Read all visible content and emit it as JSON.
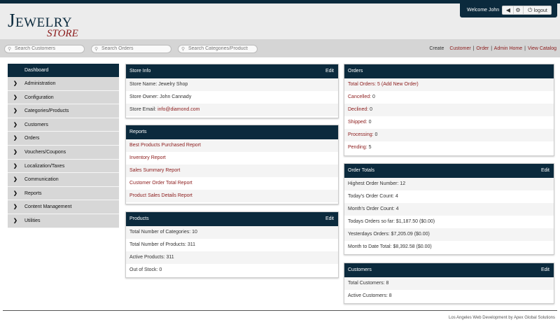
{
  "logo": {
    "top": "Jewelry",
    "bottom": "Store"
  },
  "user": {
    "welcome": "Welcome John",
    "logout": "logout"
  },
  "search": {
    "customers_placeholder": "Search Customers",
    "orders_placeholder": "Search Orders",
    "categories_placeholder": "Search Categories/Products"
  },
  "toplinks": {
    "create": "Create",
    "customer": "Customer",
    "order": "Order",
    "admin_home": "Admin Home",
    "view_catalog": "View Catalog",
    "sep": "|"
  },
  "sidebar": {
    "header": "Dashboard",
    "chevron": "❯",
    "items": [
      {
        "label": "Administration"
      },
      {
        "label": "Configuration"
      },
      {
        "label": "Categories/Products"
      },
      {
        "label": "Customers"
      },
      {
        "label": "Orders"
      },
      {
        "label": "Vouchers/Coupons"
      },
      {
        "label": "Localization/Taxes"
      },
      {
        "label": "Communication"
      },
      {
        "label": "Reports"
      },
      {
        "label": "Content Management"
      },
      {
        "label": "Utilities"
      }
    ]
  },
  "store_info": {
    "title": "Store Info",
    "edit": "Edit",
    "name": "Store Name: Jewelry Shop",
    "owner": "Store Owner: John Cannady",
    "email_label": "Store Email: ",
    "email": "info@diamond.com"
  },
  "reports": {
    "title": "Reports",
    "items": [
      "Best Products Purchased Report",
      "Inventory Report",
      "Sales Summary Report",
      "Customer Order Total Report",
      "Product Sales Details Report"
    ]
  },
  "products": {
    "title": "Products",
    "edit": "Edit",
    "rows": [
      "Total Number of Categories: 10",
      "Total Number of Products: 311",
      "Active Products: 311",
      "Out of Stock: 0"
    ]
  },
  "orders": {
    "title": "Orders",
    "total_label": "Total Orders: 5 ",
    "add_new": "(Add New Order)",
    "statuses": [
      {
        "label": "Cancelled:",
        "count": " 0"
      },
      {
        "label": "Declined:",
        "count": " 0"
      },
      {
        "label": "Shipped:",
        "count": " 0"
      },
      {
        "label": "Processing:",
        "count": " 0"
      },
      {
        "label": "Pending:",
        "count": " 5"
      }
    ]
  },
  "order_totals": {
    "title": "Order Totals",
    "edit": "Edit",
    "rows": [
      "Highest Order Number: 12",
      "Today's Order Count: 4",
      "Month's Order Count: 4",
      "Todays Orders so far: $1,187.50 ($0.00)",
      "Yesterdays Orders: $7,205.09 ($0.00)",
      "Month to Date Total: $8,392.58 ($0.00)"
    ]
  },
  "customers": {
    "title": "Customers",
    "edit": "Edit",
    "rows": [
      "Total Customers: 8",
      "Active Customers: 8"
    ]
  },
  "footer": {
    "text": "Los Angeles Web Development by Apex Global Solutions"
  },
  "colors": {
    "navy": "#0b2a3d",
    "link": "#8b1a1a"
  }
}
